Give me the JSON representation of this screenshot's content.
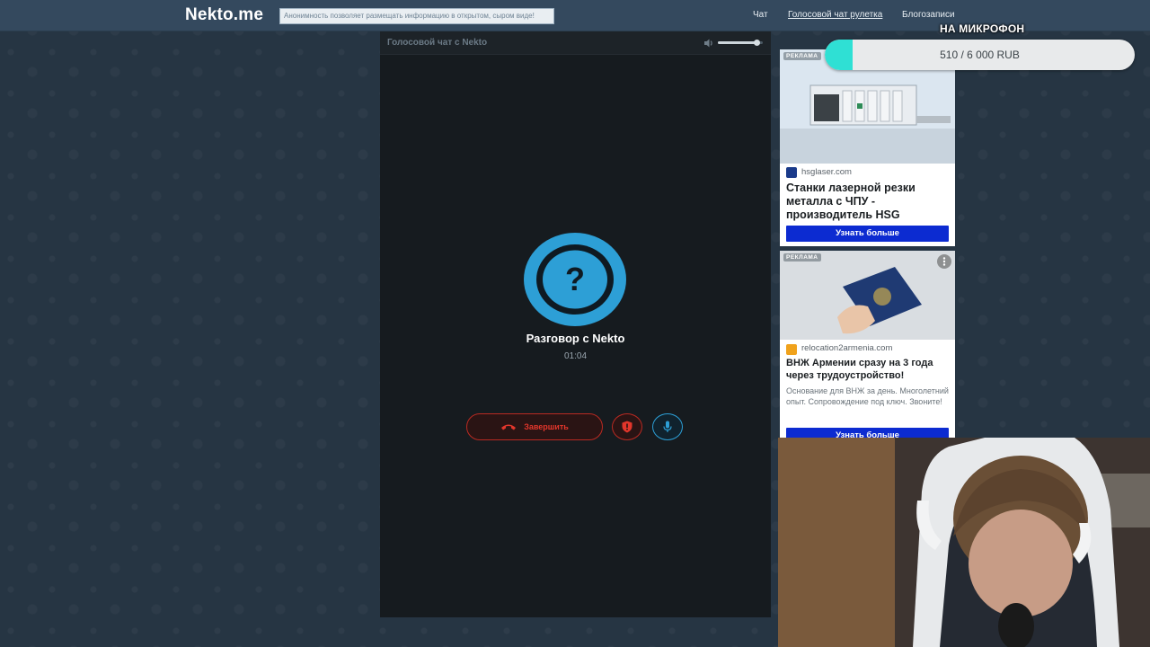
{
  "header": {
    "logo": "Nekto.me",
    "ticker": "Анонимность позволяет размещать информацию в открытом, сыром виде!",
    "nav": [
      "Чат",
      "Голосовой чат рулетка",
      "Блогозаписи"
    ],
    "active_nav_index": 1
  },
  "chat": {
    "panel_title": "Голосовой чат с Nekto",
    "volume_level": 0.85,
    "avatar_symbol": "?",
    "title": "Разговор с Nekto",
    "timer": "01:04",
    "end_button_label": "Завершить"
  },
  "ads": [
    {
      "label": "РЕКЛАМА",
      "domain": "hsglaser.com",
      "headline": "Станки лазерной резки металла с ЧПУ - производитель HSG",
      "cta": "Узнать больше"
    },
    {
      "label": "РЕКЛАМА",
      "domain": "relocation2armenia.com",
      "headline": "ВНЖ Армении сразу на 3 года через трудоустройство!",
      "description": "Основание для ВНЖ за день. Многолетний опыт. Сопровождение под ключ. Звоните!",
      "cta": "Узнать больше"
    }
  ],
  "overlay": {
    "goal_title": "НА МИКРОФОН",
    "goal_text": "510 / 6 000 RUB",
    "goal_progress": 0.085
  },
  "colors": {
    "accent_blue": "#2d9fd6",
    "danger_red": "#e3362b",
    "ad_cta_blue": "#0c2bd1",
    "goal_cyan": "#2fe0d4"
  }
}
